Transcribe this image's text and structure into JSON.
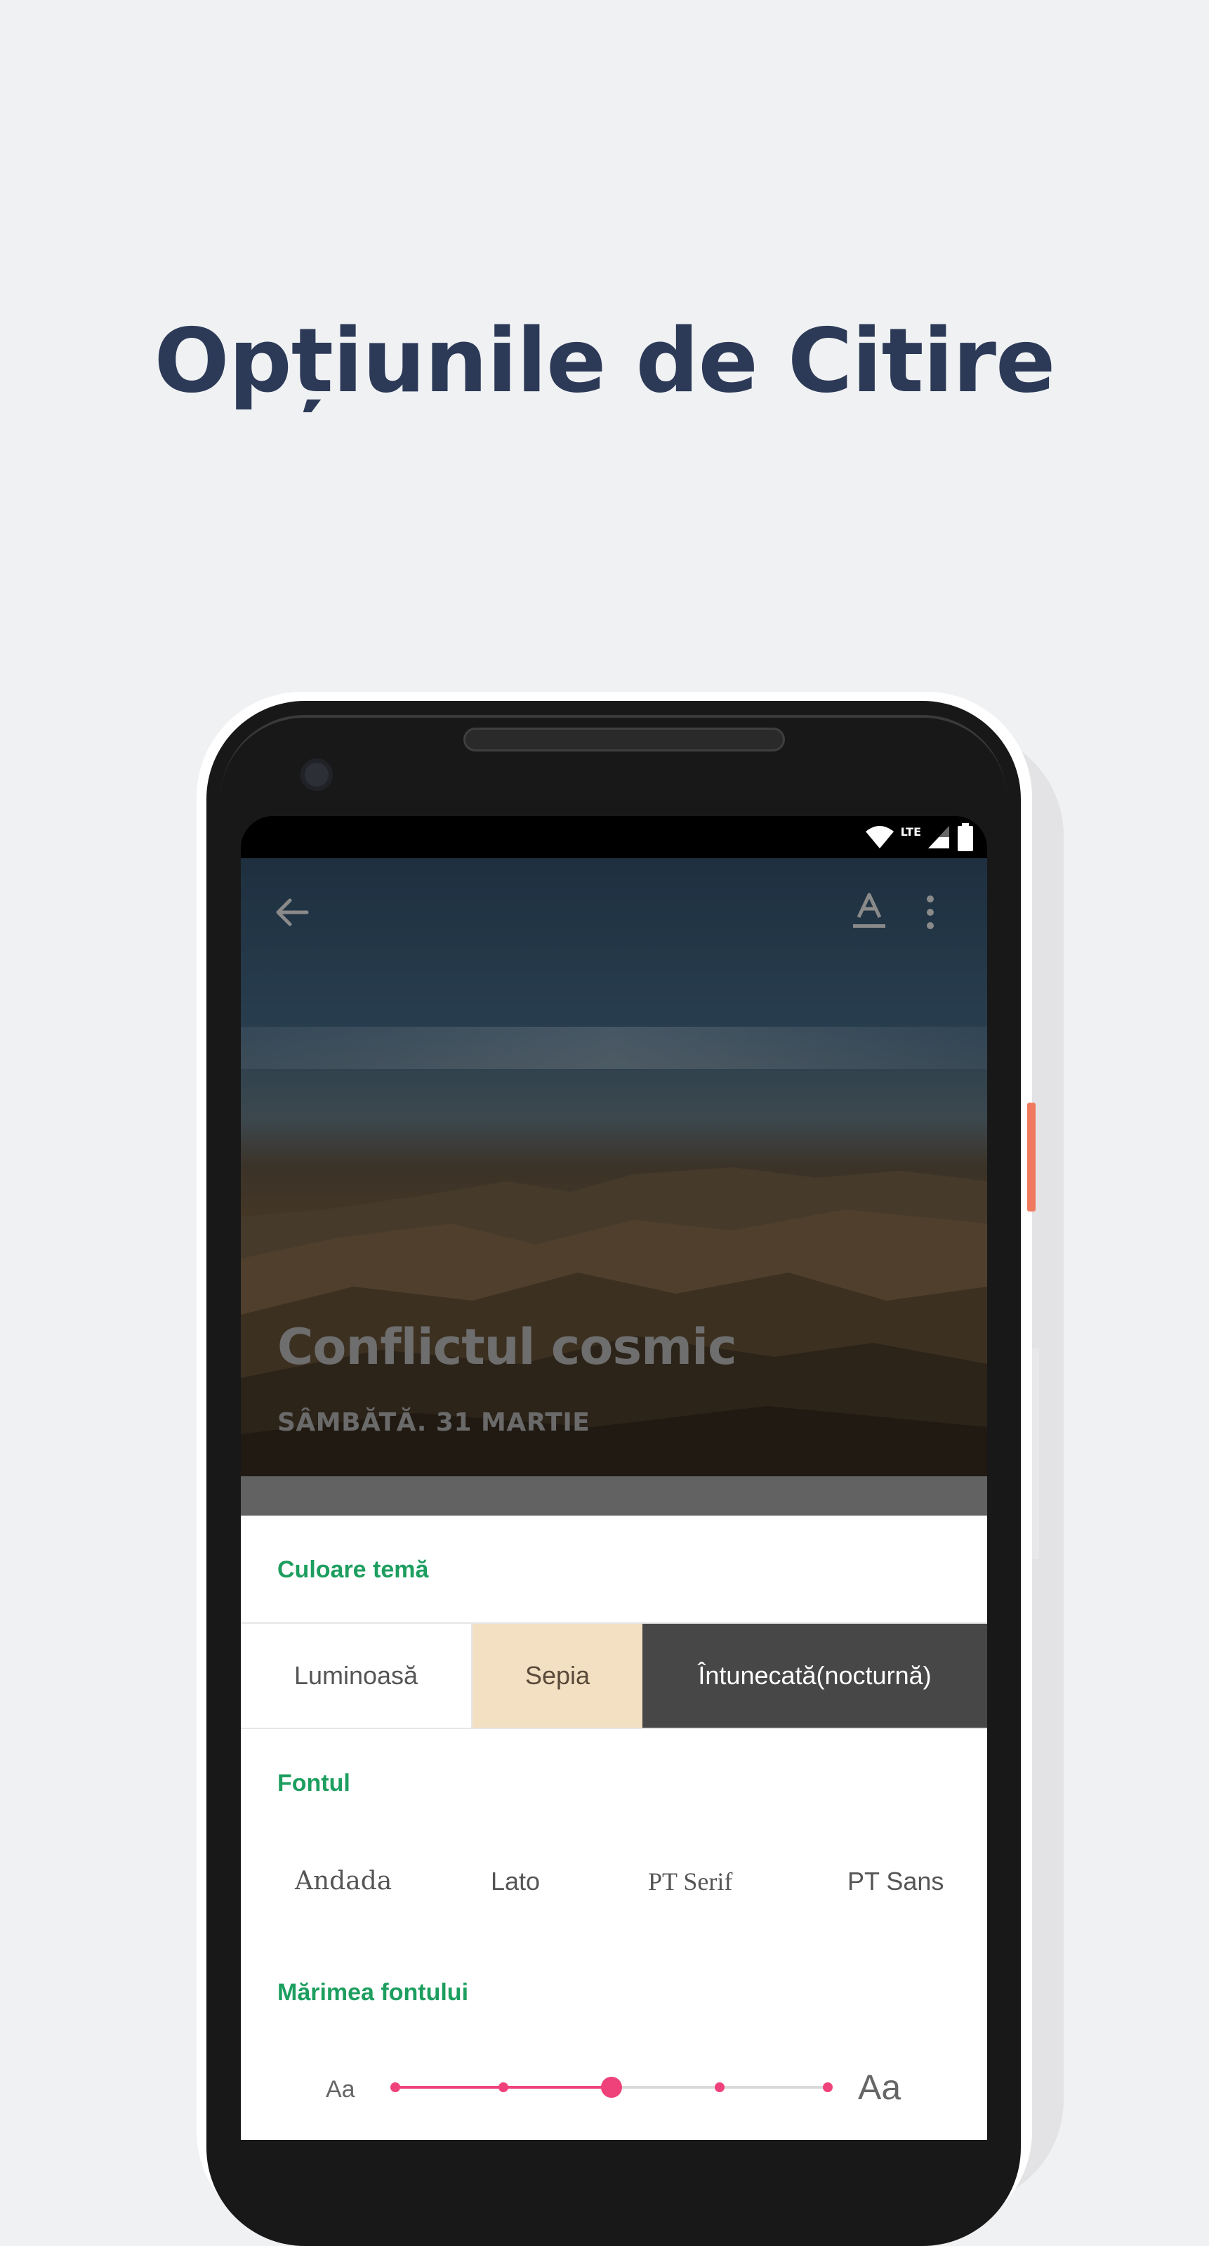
{
  "headline": "Opțiunile de Citire",
  "status_bar": {
    "network_label": "LTE"
  },
  "toolbar": {
    "back_icon": "arrow-left-icon",
    "font_icon": "text-format-icon",
    "more_icon": "more-vertical-icon"
  },
  "article": {
    "title": "Conflictul cosmic",
    "date": "SÂMBĂTĂ. 31 MARTIE"
  },
  "settings": {
    "theme_label": "Culoare temă",
    "themes": [
      {
        "label": "Luminoasă",
        "color": "#ffffff"
      },
      {
        "label": "Sepia",
        "color": "#f3dfc2",
        "selected": true
      },
      {
        "label": "Întunecată(nocturnă)",
        "color": "#474747"
      }
    ],
    "font_label": "Fontul",
    "fonts": [
      "Andada",
      "Lato",
      "PT Serif",
      "PT Sans"
    ],
    "size_label": "Mărimea fontului",
    "size_small_label": "Aa",
    "size_large_label": "Aa",
    "size_steps": 5,
    "size_selected_index": 2
  },
  "colors": {
    "accent_green": "#1d9e5f",
    "slider_pink": "#f0427a",
    "headline": "#2c3a57"
  }
}
